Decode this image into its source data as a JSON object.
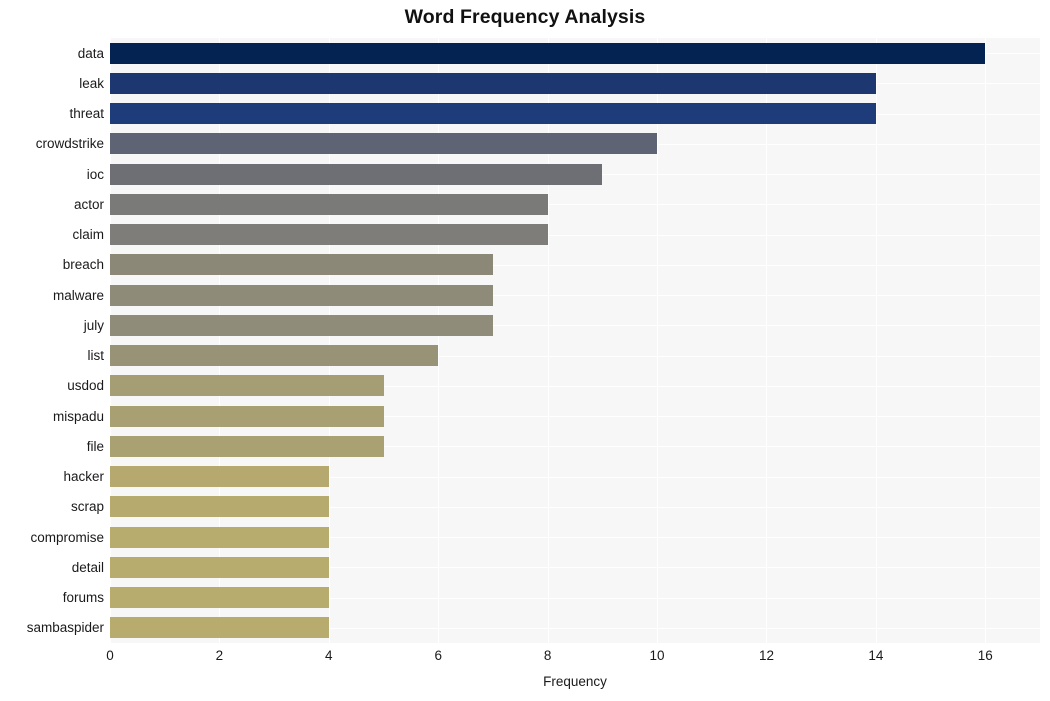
{
  "chart_data": {
    "type": "bar",
    "orientation": "horizontal",
    "title": "Word Frequency Analysis",
    "xlabel": "Frequency",
    "ylabel": "",
    "xlim": [
      0,
      17
    ],
    "xticks": [
      0,
      2,
      4,
      6,
      8,
      10,
      12,
      14,
      16
    ],
    "grid": true,
    "grid_axis": "both",
    "legend": false,
    "categories": [
      "data",
      "leak",
      "threat",
      "crowdstrike",
      "ioc",
      "actor",
      "claim",
      "breach",
      "malware",
      "july",
      "list",
      "usdod",
      "mispadu",
      "file",
      "hacker",
      "scrap",
      "compromise",
      "detail",
      "forums",
      "sambaspider"
    ],
    "values": [
      16,
      14,
      14,
      10,
      9,
      8,
      8,
      7,
      7,
      7,
      6,
      5,
      5,
      5,
      4,
      4,
      4,
      4,
      4,
      4
    ],
    "bar_colors": [
      "#042252",
      "#1d3771",
      "#1f3c7a",
      "#5f6474",
      "#6e6f74",
      "#7a7a78",
      "#7e7d79",
      "#8b8878",
      "#8e8b79",
      "#8f8c79",
      "#989277",
      "#a59d74",
      "#a89f73",
      "#aaa172",
      "#b5a96f",
      "#b6aa6f",
      "#b7ab6e",
      "#b8ab6e",
      "#b8ab6e",
      "#b8ab6e"
    ]
  },
  "plot_background_color": "#f7f7f7",
  "figure_background_color": "#ffffff",
  "gridline_color": "#ffffff"
}
